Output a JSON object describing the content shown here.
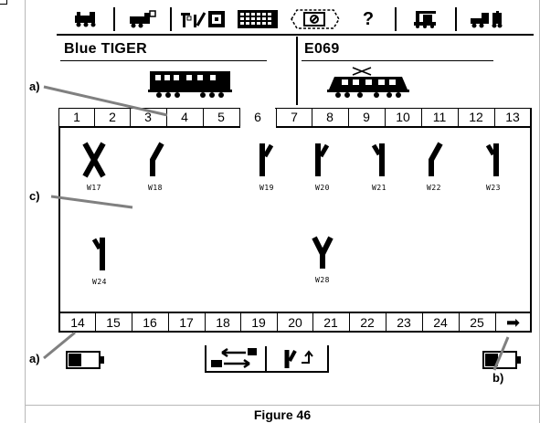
{
  "toolbar": {
    "icons": [
      "loco-front-icon",
      "loco-list-icon",
      "signal-switch-icon",
      "keyboard-grid-icon",
      "settings-display-icon",
      "help-icon",
      "crane-icon",
      "loco-add-icon"
    ],
    "help_label": "?"
  },
  "locos": {
    "left": {
      "name": "Blue TIGER"
    },
    "right": {
      "name": "E069"
    }
  },
  "tabs_top": [
    "1",
    "2",
    "3",
    "4",
    "5",
    "6",
    "7",
    "8",
    "9",
    "10",
    "11",
    "12",
    "13"
  ],
  "active_tab": "6",
  "tabs_bottom": [
    "14",
    "15",
    "16",
    "17",
    "18",
    "19",
    "20",
    "21",
    "22",
    "23",
    "24",
    "25"
  ],
  "next_arrow": "➡",
  "switches": [
    {
      "id": "W17",
      "label": "W17",
      "glyph": "X"
    },
    {
      "id": "W18",
      "label": "W18",
      "glyph": "/"
    },
    {
      "id": "W19",
      "label": "W19",
      "glyph": "|/"
    },
    {
      "id": "W20",
      "label": "W20",
      "glyph": "|/"
    },
    {
      "id": "W21",
      "label": "W21",
      "glyph": "\\|"
    },
    {
      "id": "W22",
      "label": "W22",
      "glyph": "/"
    },
    {
      "id": "W23",
      "label": "W23",
      "glyph": "\\|"
    },
    {
      "id": "W24",
      "label": "W24",
      "glyph": "\\|"
    },
    {
      "id": "W28",
      "label": "W28",
      "glyph": "Y"
    }
  ],
  "callouts": {
    "a_top": "a)",
    "c": "c)",
    "a_bottom": "a)",
    "b": "b)"
  },
  "caption": "Figure 46",
  "colors": {
    "ink": "#000000",
    "frame": "#b8b8b8",
    "callout_line": "#808080"
  }
}
